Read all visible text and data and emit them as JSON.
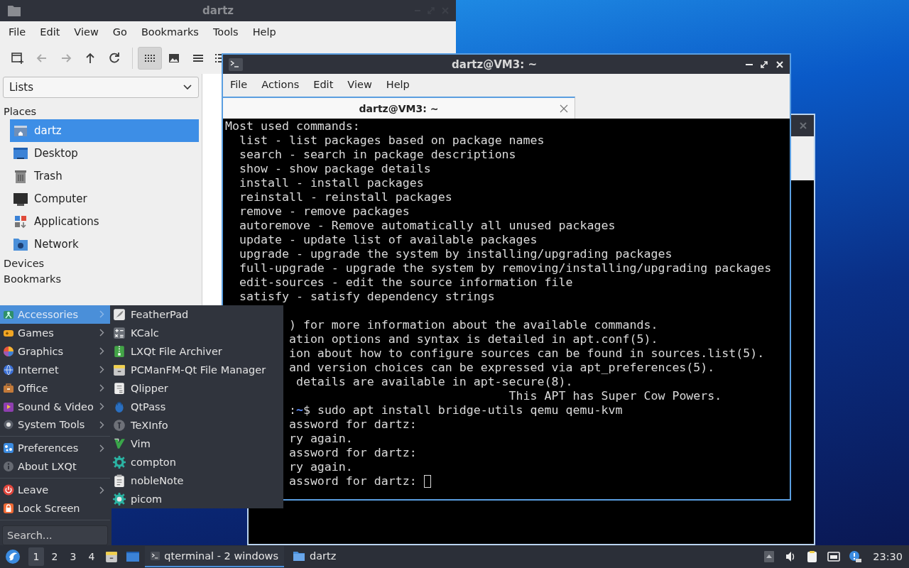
{
  "file_manager": {
    "title": "dartz",
    "menu": [
      "File",
      "Edit",
      "View",
      "Go",
      "Bookmarks",
      "Tools",
      "Help"
    ],
    "toolbar": [
      {
        "selected": false,
        "disabled": false
      },
      {
        "selected": false,
        "disabled": true
      },
      {
        "selected": false,
        "disabled": true
      },
      {
        "selected": false,
        "disabled": false
      },
      {
        "selected": false,
        "disabled": false
      },
      {
        "selected": true,
        "disabled": false
      },
      {
        "selected": false,
        "disabled": false
      },
      {
        "selected": false,
        "disabled": false
      },
      {
        "selected": false,
        "disabled": false
      }
    ],
    "view_selector": {
      "value": "Lists"
    },
    "sidebar": [
      {
        "label": "Places",
        "items": [
          {
            "label": "dartz",
            "selected": true
          },
          {
            "label": "Desktop",
            "selected": false
          },
          {
            "label": "Trash",
            "selected": false
          },
          {
            "label": "Computer",
            "selected": false
          },
          {
            "label": "Applications",
            "selected": false
          },
          {
            "label": "Network",
            "selected": false
          }
        ]
      },
      {
        "label": "Devices"
      },
      {
        "label": "Bookmarks"
      }
    ]
  },
  "terminal": {
    "title": "dartz@VM3: ~",
    "menu": [
      "File",
      "Actions",
      "Edit",
      "View",
      "Help"
    ],
    "tabs": [
      {
        "label": "dartz@VM3: ~",
        "selected": true
      }
    ],
    "lines": [
      {
        "kind": "full",
        "text": "Most used commands:"
      },
      {
        "kind": "full",
        "text": "  list - list packages based on package names"
      },
      {
        "kind": "full",
        "text": "  search - search in package descriptions"
      },
      {
        "kind": "full",
        "text": "  show - show package details"
      },
      {
        "kind": "full",
        "text": "  install - install packages"
      },
      {
        "kind": "full",
        "text": "  reinstall - reinstall packages"
      },
      {
        "kind": "full",
        "text": "  remove - remove packages"
      },
      {
        "kind": "full",
        "text": "  autoremove - Remove automatically all unused packages"
      },
      {
        "kind": "full",
        "text": "  update - update list of available packages"
      },
      {
        "kind": "full",
        "text": "  upgrade - upgrade the system by installing/upgrading packages"
      },
      {
        "kind": "full",
        "text": "  full-upgrade - upgrade the system by removing/installing/upgrading packages"
      },
      {
        "kind": "full",
        "text": "  edit-sources - edit the source information file"
      },
      {
        "kind": "full",
        "text": "  satisfy - satisfy dependency strings"
      },
      {
        "kind": "blank"
      },
      {
        "kind": "clipped",
        "text": ") for more information about the available commands."
      },
      {
        "kind": "clipped",
        "text": "ation options and syntax is detailed in apt.conf(5)."
      },
      {
        "kind": "clipped",
        "text": "ion about how to configure sources can be found in sources.list(5)."
      },
      {
        "kind": "clipped",
        "text": "and version choices can be expressed via apt_preferences(5)."
      },
      {
        "kind": "clipped",
        "text": " details are available in apt-secure(8)."
      },
      {
        "kind": "full",
        "text": "                                        This APT has Super Cow Powers."
      },
      {
        "kind": "prompt",
        "prefix": ":",
        "path": "~",
        "command": "$ sudo apt install bridge-utils qemu qemu-kvm"
      },
      {
        "kind": "clipped",
        "text": "assword for dartz:"
      },
      {
        "kind": "clipped",
        "text": "ry again."
      },
      {
        "kind": "clipped",
        "text": "assword for dartz:"
      },
      {
        "kind": "clipped",
        "text": "ry again."
      },
      {
        "kind": "clipped",
        "text": "assword for dartz: ",
        "cursor": true
      }
    ]
  },
  "app_menu": {
    "groups": [
      [
        {
          "label": "Accessories",
          "selected": true,
          "has_submenu": true
        },
        {
          "label": "Games",
          "selected": false,
          "has_submenu": true
        },
        {
          "label": "Graphics",
          "selected": false,
          "has_submenu": true
        },
        {
          "label": "Internet",
          "selected": false,
          "has_submenu": true
        },
        {
          "label": "Office",
          "selected": false,
          "has_submenu": true
        },
        {
          "label": "Sound & Video",
          "selected": false,
          "has_submenu": true
        },
        {
          "label": "System Tools",
          "selected": false,
          "has_submenu": true
        }
      ],
      [
        {
          "label": "Preferences",
          "selected": false,
          "has_submenu": true
        },
        {
          "label": "About LXQt",
          "selected": false,
          "has_submenu": false
        }
      ],
      [
        {
          "label": "Leave",
          "selected": false,
          "has_submenu": true
        },
        {
          "label": "Lock Screen",
          "selected": false,
          "has_submenu": false
        }
      ]
    ],
    "search": {
      "placeholder": "Search..."
    },
    "submenu": [
      "FeatherPad",
      "KCalc",
      "LXQt File Archiver",
      "PCManFM-Qt File Manager",
      "Qlipper",
      "QtPass",
      "TeXInfo",
      "Vim",
      "compton",
      "nobleNote",
      "picom"
    ]
  },
  "taskbar": {
    "desktops": [
      {
        "label": "1",
        "selected": true
      },
      {
        "label": "2",
        "selected": false
      },
      {
        "label": "3",
        "selected": false
      },
      {
        "label": "4",
        "selected": false
      }
    ],
    "tasks": [
      {
        "label": "qterminal - 2 windows",
        "selected": true
      },
      {
        "label": "dartz",
        "selected": false
      }
    ],
    "clock": "23:30"
  }
}
